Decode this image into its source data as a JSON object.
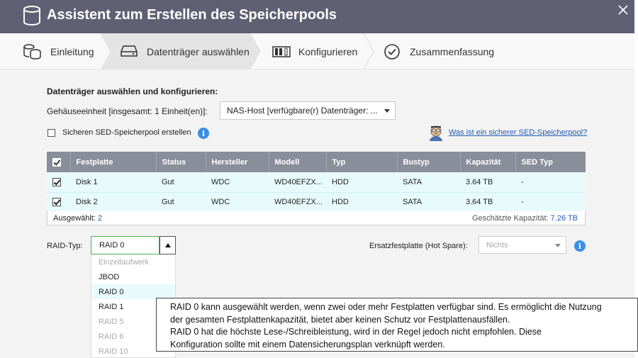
{
  "window": {
    "title": "Assistent zum Erstellen des Speicherpools"
  },
  "steps": [
    {
      "label": "Einleitung"
    },
    {
      "label": "Datenträger auswählen"
    },
    {
      "label": "Konfigurieren"
    },
    {
      "label": "Zusammenfassung"
    }
  ],
  "section_heading": "Datenträger auswählen und konfigurieren:",
  "enclosure": {
    "label": "Gehäuseeinheit [insgesamt: 1 Einheit(en)]:",
    "value": "NAS-Host [verfügbare(r) Datenträger: ..."
  },
  "sed": {
    "checkbox_label": "Sicheren SED-Speicherpool erstellen",
    "help_link": "Was ist ein sicherer SED-Speicherpool?"
  },
  "table": {
    "columns": [
      "Festplatte",
      "Status",
      "Hersteller",
      "Modell",
      "Typ",
      "Bustyp",
      "Kapazität",
      "SED Typ"
    ],
    "rows": [
      {
        "disk": "Disk 1",
        "status": "Gut",
        "vendor": "WDC",
        "model": "WD40EFZX...",
        "type": "HDD",
        "bus": "SATA",
        "capacity": "3.64 TB",
        "sed": "-"
      },
      {
        "disk": "Disk 2",
        "status": "Gut",
        "vendor": "WDC",
        "model": "WD40EFZX...",
        "type": "HDD",
        "bus": "SATA",
        "capacity": "3.64 TB",
        "sed": "-"
      }
    ],
    "footer": {
      "selected_label": "Ausgewählt:",
      "selected_count": "2",
      "capacity_label": "Geschätzte Kapazität:",
      "capacity_value": "7.26 TB"
    }
  },
  "raid": {
    "label": "RAID-Typ:",
    "value": "RAID 0",
    "options": [
      {
        "label": "Einzellaufwerk",
        "disabled": true
      },
      {
        "label": "JBOD",
        "disabled": false
      },
      {
        "label": "RAID 0",
        "disabled": false,
        "selected": true
      },
      {
        "label": "RAID 1",
        "disabled": false
      },
      {
        "label": "RAID 5",
        "disabled": true
      },
      {
        "label": "RAID 6",
        "disabled": true
      },
      {
        "label": "RAID 10",
        "disabled": true
      }
    ]
  },
  "hot_spare": {
    "label": "Ersatzfestplatte (Hot Spare):",
    "value": "Nichts"
  },
  "tooltip": {
    "lines": [
      "RAID 0 kann ausgewählt werden, wenn zwei oder mehr Festplatten verfügbar sind. Es ermöglicht die Nutzung",
      "der gesamten Festplattenkapazität, bietet aber keinen Schutz vor Festplattenausfällen.",
      "RAID 0 hat die höchste Lese-/Schreibleistung, wird in der Regel jedoch nicht empfohlen. Diese",
      "Konfiguration sollte mit einem Datensicherungsplan verknüpft werden."
    ]
  },
  "colors": {
    "titlebar": "#5f6073",
    "table_header": "#8a8d9a",
    "row_bg": "#e8fbfc",
    "link": "#1e5bb8",
    "info": "#3a8ee6",
    "focus": "#4caf50"
  }
}
